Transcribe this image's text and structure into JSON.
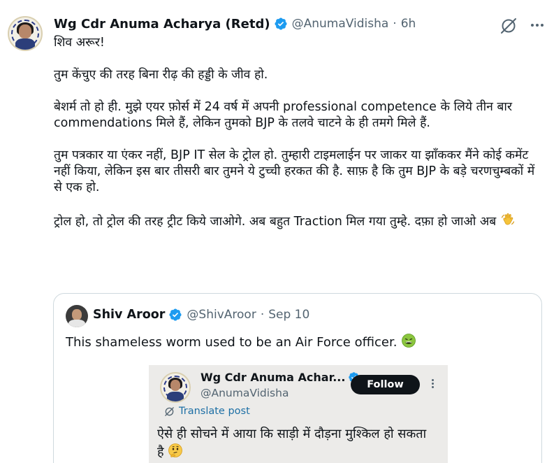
{
  "tweet": {
    "author_name": "Wg Cdr Anuma Acharya (Retd)",
    "handle": "@AnumaVidisha",
    "separator": "·",
    "time": "6h",
    "paragraphs": [
      "शिव अरूर!",
      "तुम केंचुए की तरह बिना रीढ़ की हड्डी के जीव हो.",
      "बेशर्म तो हो ही. मुझे एयर फ़ोर्स में 24 वर्ष में अपनी professional competence के लिये तीन बार commendations मिले हैं, लेकिन तुमको BJP के तलवे चाटने के ही तमगे मिले हैं.",
      "तुम पत्रकार या एंकर नहीं, BJP IT सेल के ट्रोल हो. तुम्हारी टाइमलाईन पर जाकर या झाँककर मैंने कोई कमेंट नहीं किया, लेकिन इस बार तीसरी बार तुमने ये टुच्ची हरकत की है. साफ़ है कि तुम BJP के बड़े चरणचुम्बकों में से एक हो.",
      "ट्रोल हो, तो ट्रोल की तरह ट्रीट किये जाओगे. अब बहुत Traction मिल गया तुम्हे. दफ़ा हो जाओ अब"
    ],
    "final_emoji": "waving-hand-emoji"
  },
  "quote": {
    "author_name": "Shiv Aroor",
    "handle": "@ShivAroor",
    "separator": "·",
    "date": "Sep 10",
    "text": "This shameless worm used to be an Air Force officer.",
    "emoji": "nauseated-face-emoji",
    "embedded": {
      "author_name": "Wg Cdr Anuma Achar...",
      "handle": "@AnumaVidisha",
      "follow_label": "Follow",
      "translate_label": "Translate post",
      "text": "ऐसे ही सोचने में आया कि साड़ी में दौड़ना मुश्किल हो सकता है",
      "emoji": "thinking-face-emoji"
    }
  },
  "colors": {
    "verified": "#1d9bf0",
    "secondary_text": "#536471",
    "link": "#1d6fa5",
    "follow_button": "#0f1419",
    "border": "#cfd9de"
  }
}
